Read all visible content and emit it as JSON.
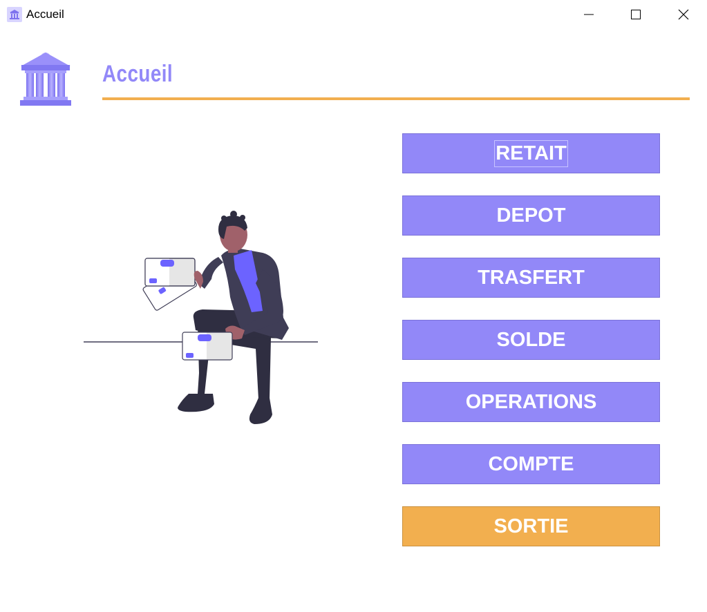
{
  "window": {
    "title": "Accueil",
    "icon": "bank-icon",
    "controls": [
      "minimize-icon",
      "maximize-icon",
      "close-icon"
    ]
  },
  "header": {
    "title": "Accueil",
    "logo_icon": "bank-building-icon"
  },
  "illustration": "person-with-cards-illustration",
  "menu": {
    "buttons": [
      {
        "label": "RETAIT"
      },
      {
        "label": "DEPOT"
      },
      {
        "label": "TRASFERT"
      },
      {
        "label": "SOLDE"
      },
      {
        "label": "OPERATIONS"
      },
      {
        "label": "COMPTE"
      },
      {
        "label": "SORTIE"
      }
    ]
  },
  "colors": {
    "accent": "#9288f8",
    "exit": "#f2af4f",
    "underline": "#f2af4f"
  }
}
